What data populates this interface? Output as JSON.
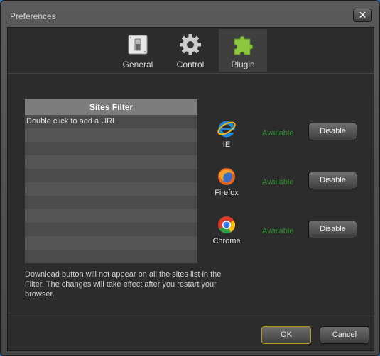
{
  "window": {
    "title": "Preferences",
    "close_label": "✕"
  },
  "tabs": [
    {
      "label": "General",
      "icon": "switch-icon"
    },
    {
      "label": "Control",
      "icon": "gear-icon"
    },
    {
      "label": "Plugin",
      "icon": "puzzle-icon",
      "active": true
    }
  ],
  "filter": {
    "header": "Sites Filter",
    "rows": [
      "Double click to add a URL",
      "",
      "",
      "",
      "",
      "",
      "",
      "",
      "",
      "",
      ""
    ]
  },
  "note": "Download button will not appear on all the sites list in the Filter. The changes will take effect after you restart your browser.",
  "browsers": [
    {
      "name": "IE",
      "status": "Available",
      "button": "Disable"
    },
    {
      "name": "Firefox",
      "status": "Available",
      "button": "Disable"
    },
    {
      "name": "Chrome",
      "status": "Available",
      "button": "Disable"
    }
  ],
  "footer": {
    "ok": "OK",
    "cancel": "Cancel"
  },
  "colors": {
    "available": "#2f8f2f",
    "ok_border": "#b8932a",
    "tab_active": "#3f3f3f"
  }
}
